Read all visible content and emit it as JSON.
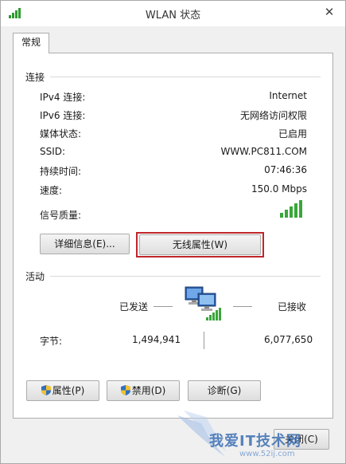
{
  "window": {
    "title": "WLAN 状态",
    "close_glyph": "✕"
  },
  "tabs": [
    {
      "label": "常规"
    }
  ],
  "connection": {
    "section_label": "连接",
    "rows": [
      {
        "label": "IPv4 连接:",
        "value": "Internet"
      },
      {
        "label": "IPv6 连接:",
        "value": "无网络访问权限"
      },
      {
        "label": "媒体状态:",
        "value": "已启用"
      },
      {
        "label": "SSID:",
        "value": "WWW.PC811.COM"
      },
      {
        "label": "持续时间:",
        "value": "07:46:36"
      },
      {
        "label": "速度:",
        "value": "150.0 Mbps"
      }
    ],
    "signal": {
      "label": "信号质量:",
      "bars_filled": 5,
      "bars_total": 5,
      "color": "#3aa63a"
    },
    "buttons": {
      "details": "详细信息(E)...",
      "wireless_properties": "无线属性(W)"
    },
    "highlight_color": "#c0262a"
  },
  "activity": {
    "section_label": "活动",
    "sent_label": "已发送",
    "received_label": "已接收",
    "bytes_label": "字节:",
    "bytes_sent": "1,494,941",
    "bytes_received": "6,077,650",
    "icon": "network-computers-icon"
  },
  "bottom_buttons": {
    "properties": "属性(P)",
    "disable": "禁用(D)",
    "diagnose": "诊断(G)",
    "close": "关闭(C)"
  },
  "watermark": {
    "title": "我爱IT技术网",
    "subtitle": "www.52ij.com"
  },
  "colors": {
    "accent_green": "#3aa63a",
    "shield_blue": "#2f6fc0",
    "shield_yellow": "#f2c230",
    "watermark_blue": "#3d6fb2"
  }
}
